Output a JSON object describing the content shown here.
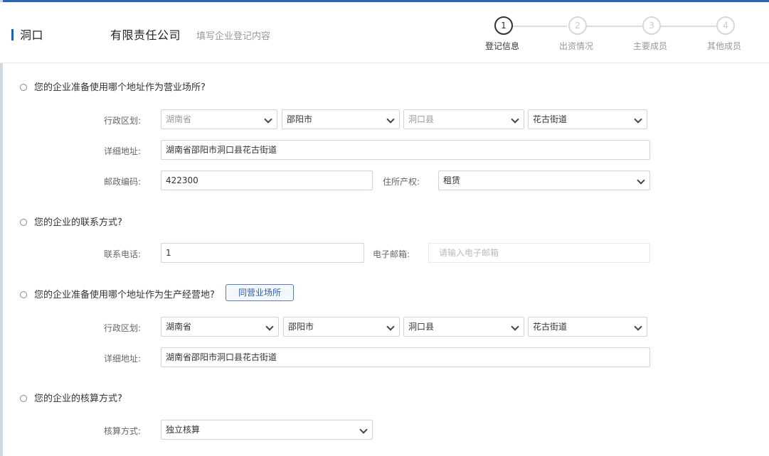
{
  "header": {
    "company_prefix": "洞口",
    "company_suffix": "有限责任公司",
    "subtitle": "填写企业登记内容",
    "steps": [
      {
        "num": "1",
        "label": "登记信息",
        "active": true
      },
      {
        "num": "2",
        "label": "出资情况",
        "active": false
      },
      {
        "num": "3",
        "label": "主要成员",
        "active": false
      },
      {
        "num": "4",
        "label": "其他成员",
        "active": false
      }
    ]
  },
  "business_address": {
    "question": "您的企业准备使用哪个地址作为营业场所?",
    "region_label": "行政区划:",
    "province": "湖南省",
    "city": "邵阳市",
    "county": "洞口县",
    "street": "花古街道",
    "detail_label": "详细地址:",
    "detail": "湖南省邵阳市洞口县花古街道",
    "postcode_label": "邮政编码:",
    "postcode": "422300",
    "property_label": "住所产权:",
    "property": "租赁"
  },
  "contact": {
    "question": "您的企业的联系方式?",
    "phone_label": "联系电话:",
    "phone": "1",
    "email_label": "电子邮箱:",
    "email_placeholder": "请输入电子邮箱"
  },
  "production_address": {
    "question": "您的企业准备使用哪个地址作为生产经营地?",
    "same_button": "同营业场所",
    "region_label": "行政区划:",
    "province": "湖南省",
    "city": "邵阳市",
    "county": "洞口县",
    "street": "花古街道",
    "detail_label": "详细地址:",
    "detail": "湖南省邵阳市洞口县花古街道"
  },
  "accounting": {
    "question": "您的企业的核算方式?",
    "method_label": "核算方式:",
    "method": "独立核算"
  }
}
